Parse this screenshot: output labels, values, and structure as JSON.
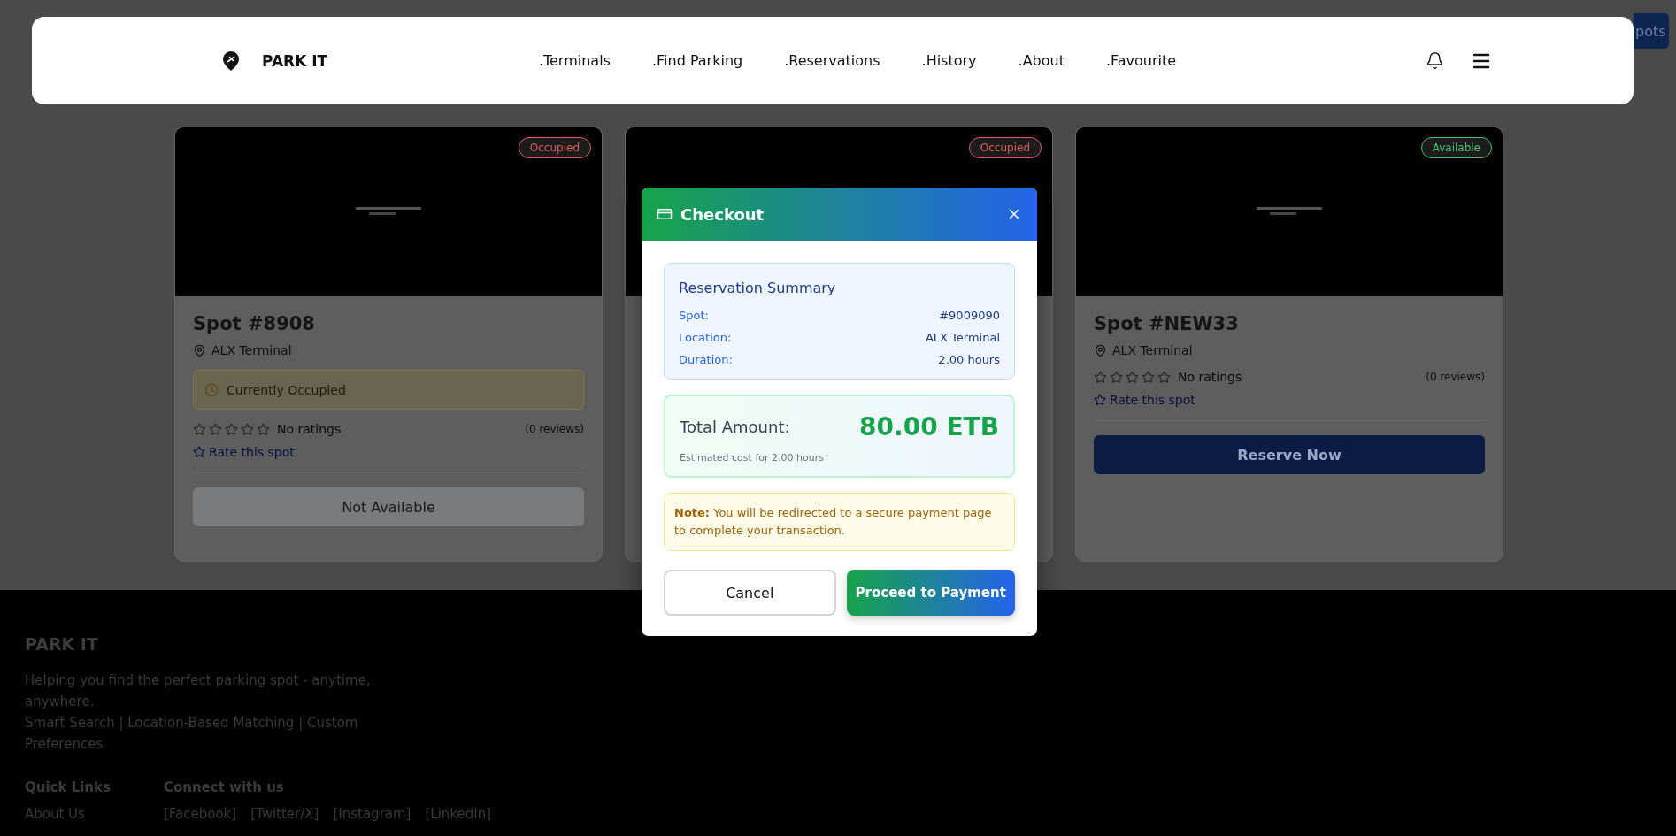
{
  "header": {
    "brand": "PARK IT",
    "corner_button": "pots",
    "nav": [
      {
        "label": ".Terminals"
      },
      {
        "label": ".Find Parking"
      },
      {
        "label": ".Reservations"
      },
      {
        "label": ".History"
      },
      {
        "label": ".About"
      },
      {
        "label": ".Favourite"
      }
    ]
  },
  "spots": [
    {
      "badge": {
        "label": "Occupied",
        "color": "#e05a5a"
      },
      "title": "Spot #8908",
      "location": "ALX Terminal",
      "notice": "Currently Occupied",
      "stars": 0,
      "rating_text": "No ratings",
      "reviews": "(0 reviews)",
      "rate_link": "Rate this spot",
      "action": {
        "label": "Not Available",
        "disabled": true
      }
    },
    {
      "badge": {
        "label": "Occupied",
        "color": "#e05a5a"
      }
    },
    {
      "badge": {
        "label": "Available",
        "color": "#4cc070"
      },
      "title": "Spot #NEW33",
      "location": "ALX Terminal",
      "stars": 0,
      "rating_text": "No ratings",
      "reviews": "(0 reviews)",
      "rate_link": "Rate this spot",
      "action": {
        "label": "Reserve Now",
        "disabled": false
      }
    }
  ],
  "checkout": {
    "title": "Checkout",
    "summary_title": "Reservation Summary",
    "summary": [
      {
        "label": "Spot:",
        "value": "#9009090"
      },
      {
        "label": "Location:",
        "value": "ALX Terminal"
      },
      {
        "label": "Duration:",
        "value": "2.00 hours"
      }
    ],
    "total_label": "Total Amount:",
    "total_value": "80.00 ETB",
    "total_note": "Estimated cost for 2.00 hours",
    "note": "**Note:** You will be redirected to a secure payment page to complete your transaction.",
    "cancel": "Cancel",
    "proceed": "Proceed to Payment"
  },
  "footer": {
    "brand": "PARK IT",
    "description": "Helping you find the perfect parking spot - anytime, anywhere.",
    "features": "Smart Search | Location-Based Matching | Custom Preferences",
    "quick_links": {
      "title": "Quick Links",
      "items": [
        "About Us"
      ]
    },
    "connect": {
      "title": "Connect with us",
      "items": [
        "[Facebook]",
        "[Twitter/X]",
        "[Instagram]",
        "[LinkedIn]"
      ]
    }
  }
}
